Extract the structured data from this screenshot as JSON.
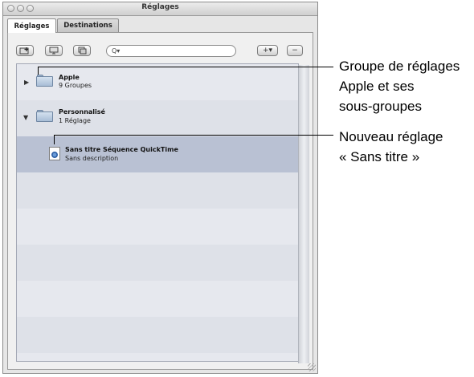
{
  "window": {
    "title": "Réglages"
  },
  "tabs": [
    {
      "label": "Réglages",
      "selected": true
    },
    {
      "label": "Destinations",
      "selected": false
    }
  ],
  "toolbar": {
    "search_placeholder": "Q▾",
    "add_label": "+▾",
    "remove_label": "−"
  },
  "list": {
    "rows": [
      {
        "name": "Apple",
        "subtitle": "9 Groupes",
        "disclosure": "▶",
        "icon": "folder-icon"
      },
      {
        "name": "Personnalisé",
        "subtitle": "1 Réglage",
        "disclosure": "▼",
        "icon": "folder-icon"
      },
      {
        "name": "Sans titre Séquence QuickTime",
        "subtitle": "Sans description",
        "icon": "quicktime-document-icon",
        "selected": true
      }
    ]
  },
  "callouts": [
    {
      "lines": [
        "Groupe de réglages",
        "Apple et ses",
        "sous-groupes"
      ]
    },
    {
      "lines": [
        "Nouveau réglage",
        "« Sans titre »"
      ]
    }
  ],
  "colors": {
    "selection": "#b9c1d3",
    "row_band": "#e6e8ee"
  }
}
